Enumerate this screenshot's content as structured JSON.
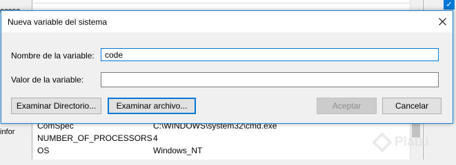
{
  "background": {
    "left_fragments": [
      "ocesa",
      "infor"
    ],
    "rows": [
      {
        "name": "ComSpec",
        "value": "C:\\WINDOWS\\system32\\cmd.exe"
      },
      {
        "name": "NUMBER_OF_PROCESSORS",
        "value": "4"
      },
      {
        "name": "OS",
        "value": "Windows_NT"
      }
    ]
  },
  "dialog": {
    "title": "Nueva variable del sistema",
    "fields": {
      "name_label": "Nombre de la variable:",
      "name_value": "code",
      "value_label": "Valor de la variable:",
      "value_value": ""
    },
    "buttons": {
      "browse_dir": "Examinar Directorio...",
      "browse_file": "Examinar archivo...",
      "ok": "Aceptar",
      "cancel": "Cancelar"
    }
  },
  "watermark": "Platzi",
  "colors": {
    "accent": "#0078d7",
    "dialog_border": "#1883d7"
  }
}
